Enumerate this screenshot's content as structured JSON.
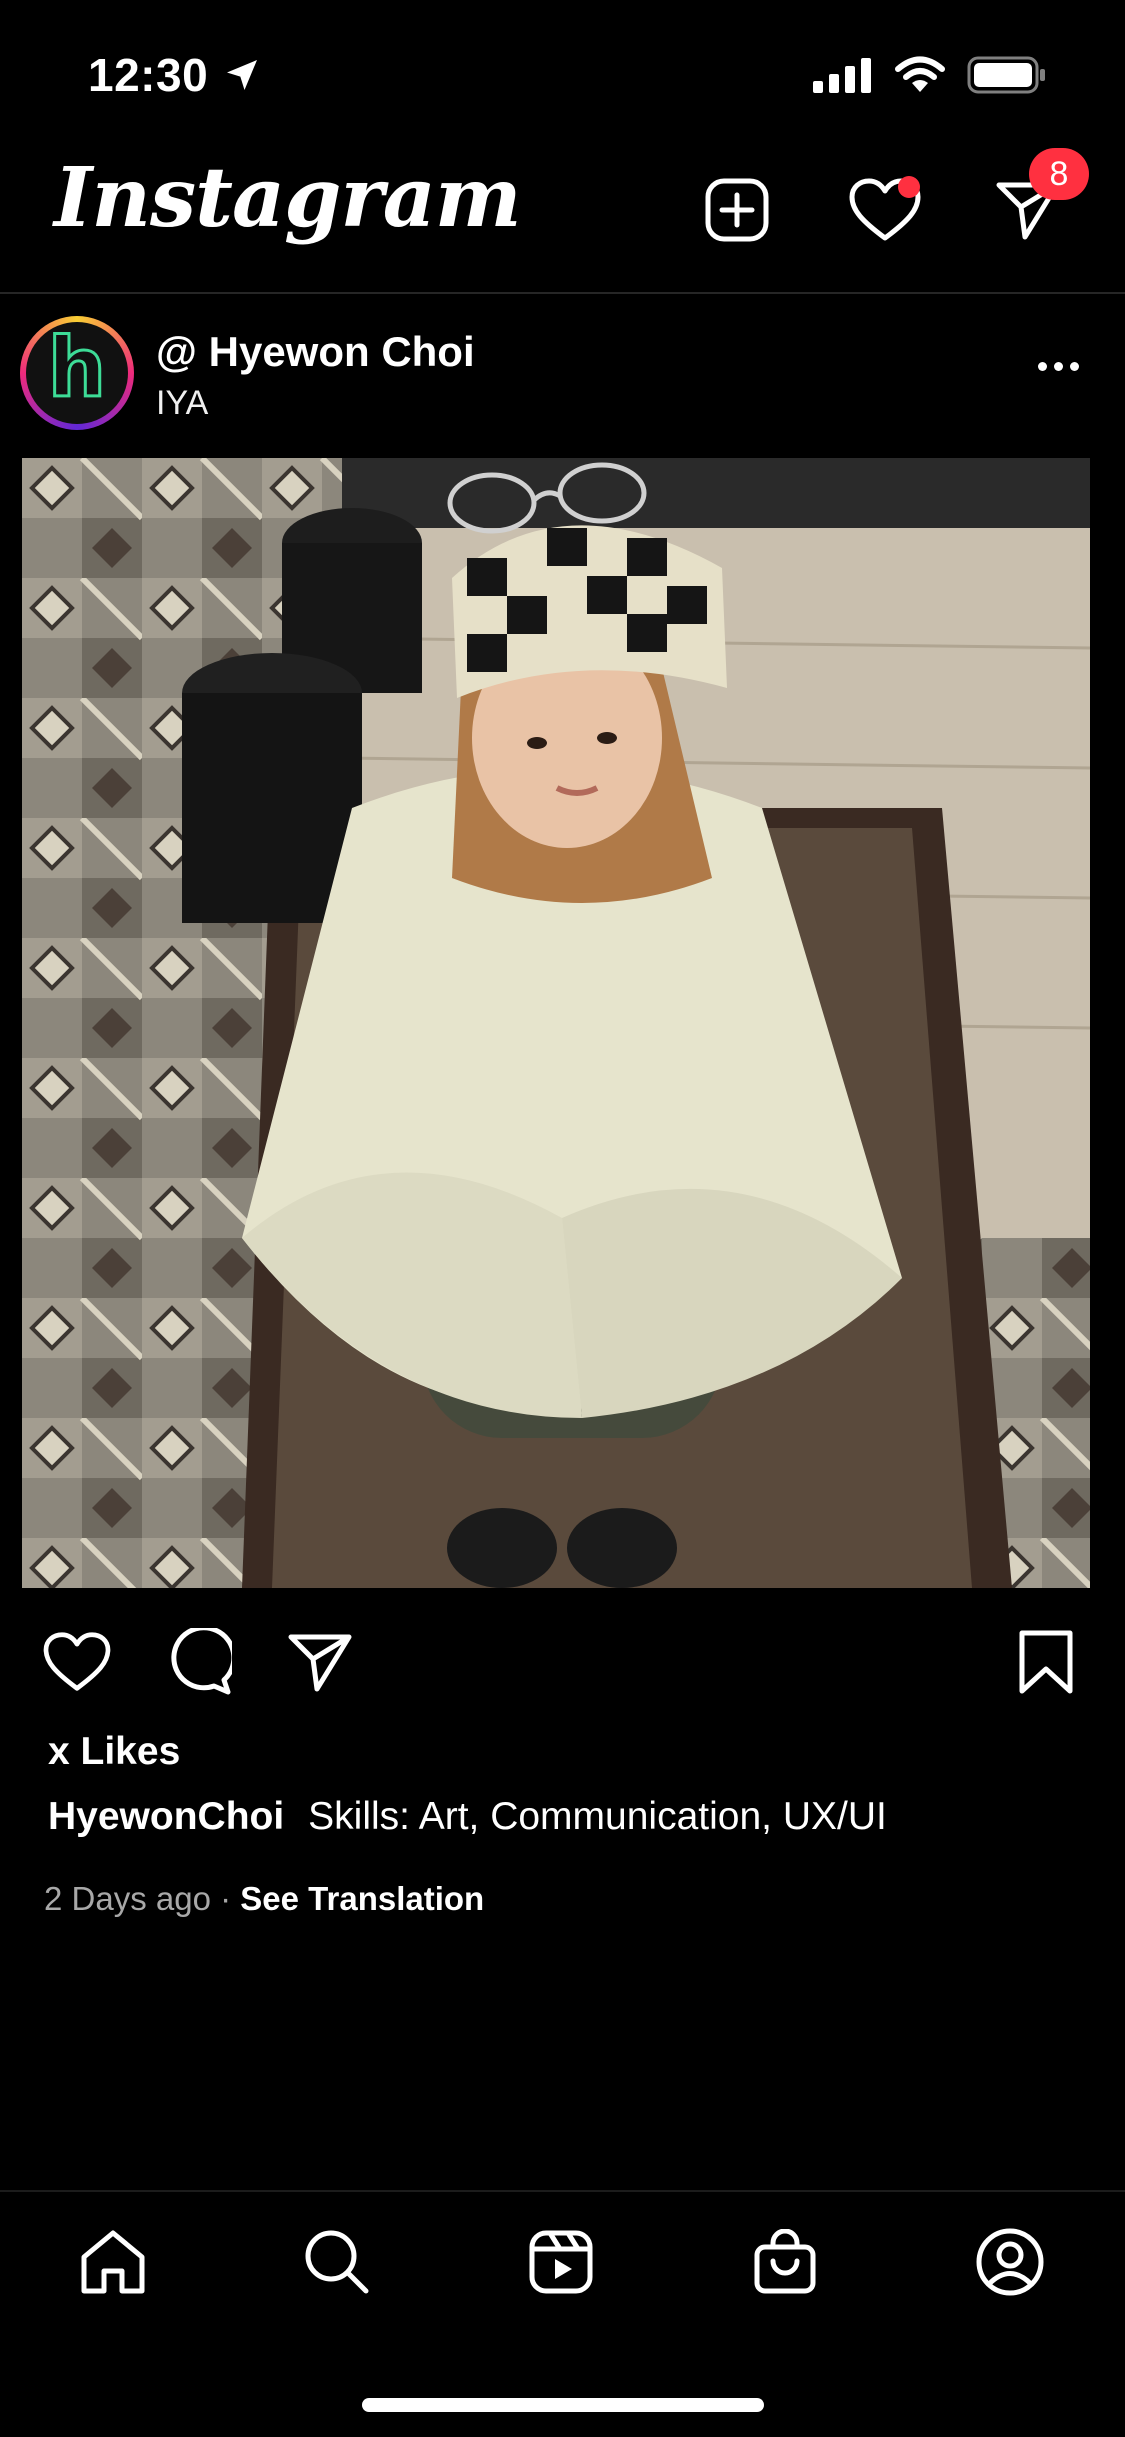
{
  "status_bar": {
    "time": "12:30"
  },
  "header": {
    "app_title": "Instagram",
    "messages_badge": "8"
  },
  "post": {
    "username": "@ Hyewon Choi",
    "subtitle": "IYA",
    "avatar_letter": "h",
    "likes": "x Likes",
    "caption_user": "HyewonChoi",
    "caption_text": "Skills: Art, Communication, UX/UI",
    "time_ago": "2 Days ago",
    "separator": "·",
    "translation_link": "See Translation"
  },
  "icons": {
    "header": [
      "plus-square-icon",
      "heart-icon",
      "direct-message-icon"
    ],
    "actions": [
      "heart-icon",
      "comment-icon",
      "share-icon",
      "bookmark-icon"
    ],
    "tabs": [
      "home-icon",
      "search-icon",
      "reels-icon",
      "shop-icon",
      "profile-icon"
    ]
  },
  "colors": {
    "badge": "#ff3040",
    "avatar_ring": [
      "#f9ce34",
      "#ee2a7b",
      "#6228d7"
    ],
    "avatar_letter": "#3ddc97"
  }
}
